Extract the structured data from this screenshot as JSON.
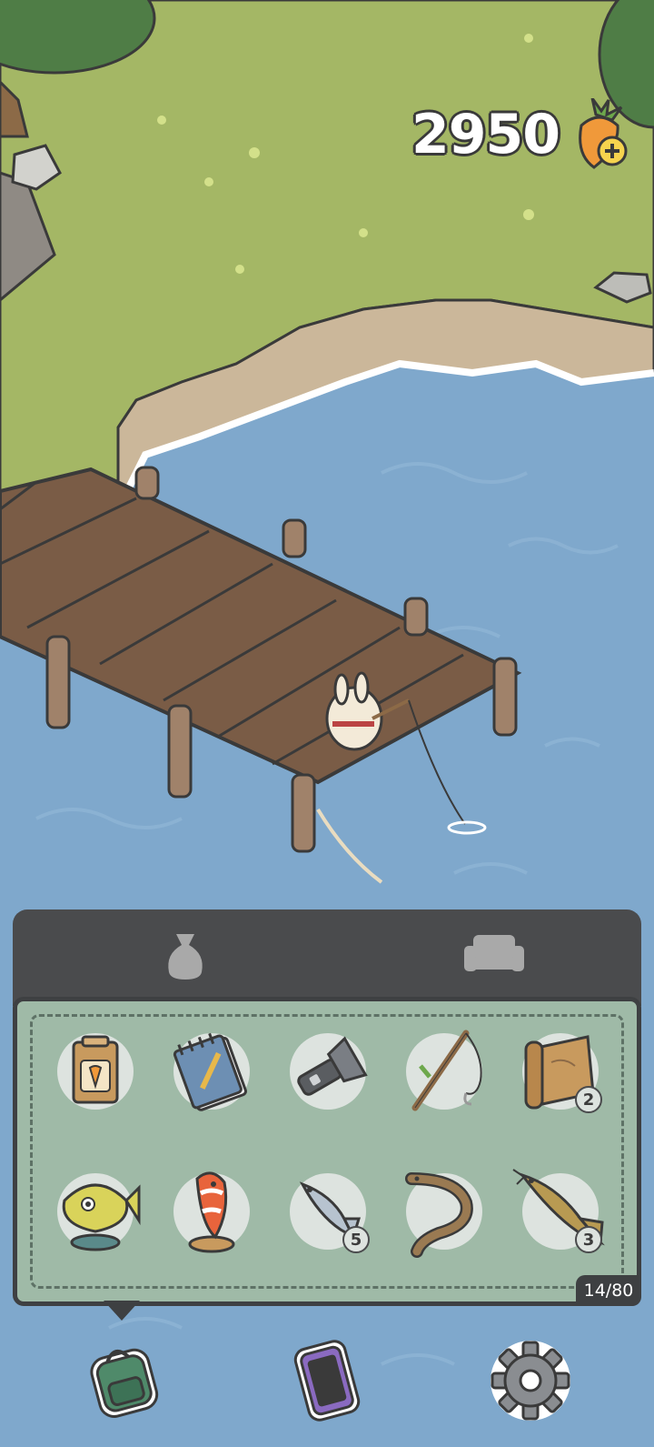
{
  "hud": {
    "carrot_amount": "2950",
    "carrot_icon": "carrot-plus-icon"
  },
  "inventory": {
    "tabs": [
      {
        "icon": "bag-icon",
        "selected": true
      },
      {
        "icon": "sofa-icon",
        "selected": false
      }
    ],
    "capacity": "14/80",
    "items": [
      {
        "icon": "carrot-seed-packet-icon",
        "count": ""
      },
      {
        "icon": "notepad-icon",
        "count": ""
      },
      {
        "icon": "flashlight-icon",
        "count": ""
      },
      {
        "icon": "fishing-rod-icon",
        "count": ""
      },
      {
        "icon": "map-scroll-icon",
        "count": "2"
      },
      {
        "icon": "pufferfish-trophy-icon",
        "count": ""
      },
      {
        "icon": "clownfish-trophy-icon",
        "count": ""
      },
      {
        "icon": "small-fish-icon",
        "count": "5"
      },
      {
        "icon": "eel-icon",
        "count": ""
      },
      {
        "icon": "catfish-icon",
        "count": "3"
      }
    ]
  },
  "bottom_bar": {
    "buttons": [
      {
        "icon": "backpack-icon"
      },
      {
        "icon": "phone-icon"
      },
      {
        "icon": "settings-gear-icon"
      }
    ]
  },
  "colors": {
    "grass": "#a4b765",
    "water": "#7fa8cc",
    "panel_dark": "#4a4b4d",
    "panel_green": "#9fbaa7",
    "slot_bg": "#dde3df"
  }
}
